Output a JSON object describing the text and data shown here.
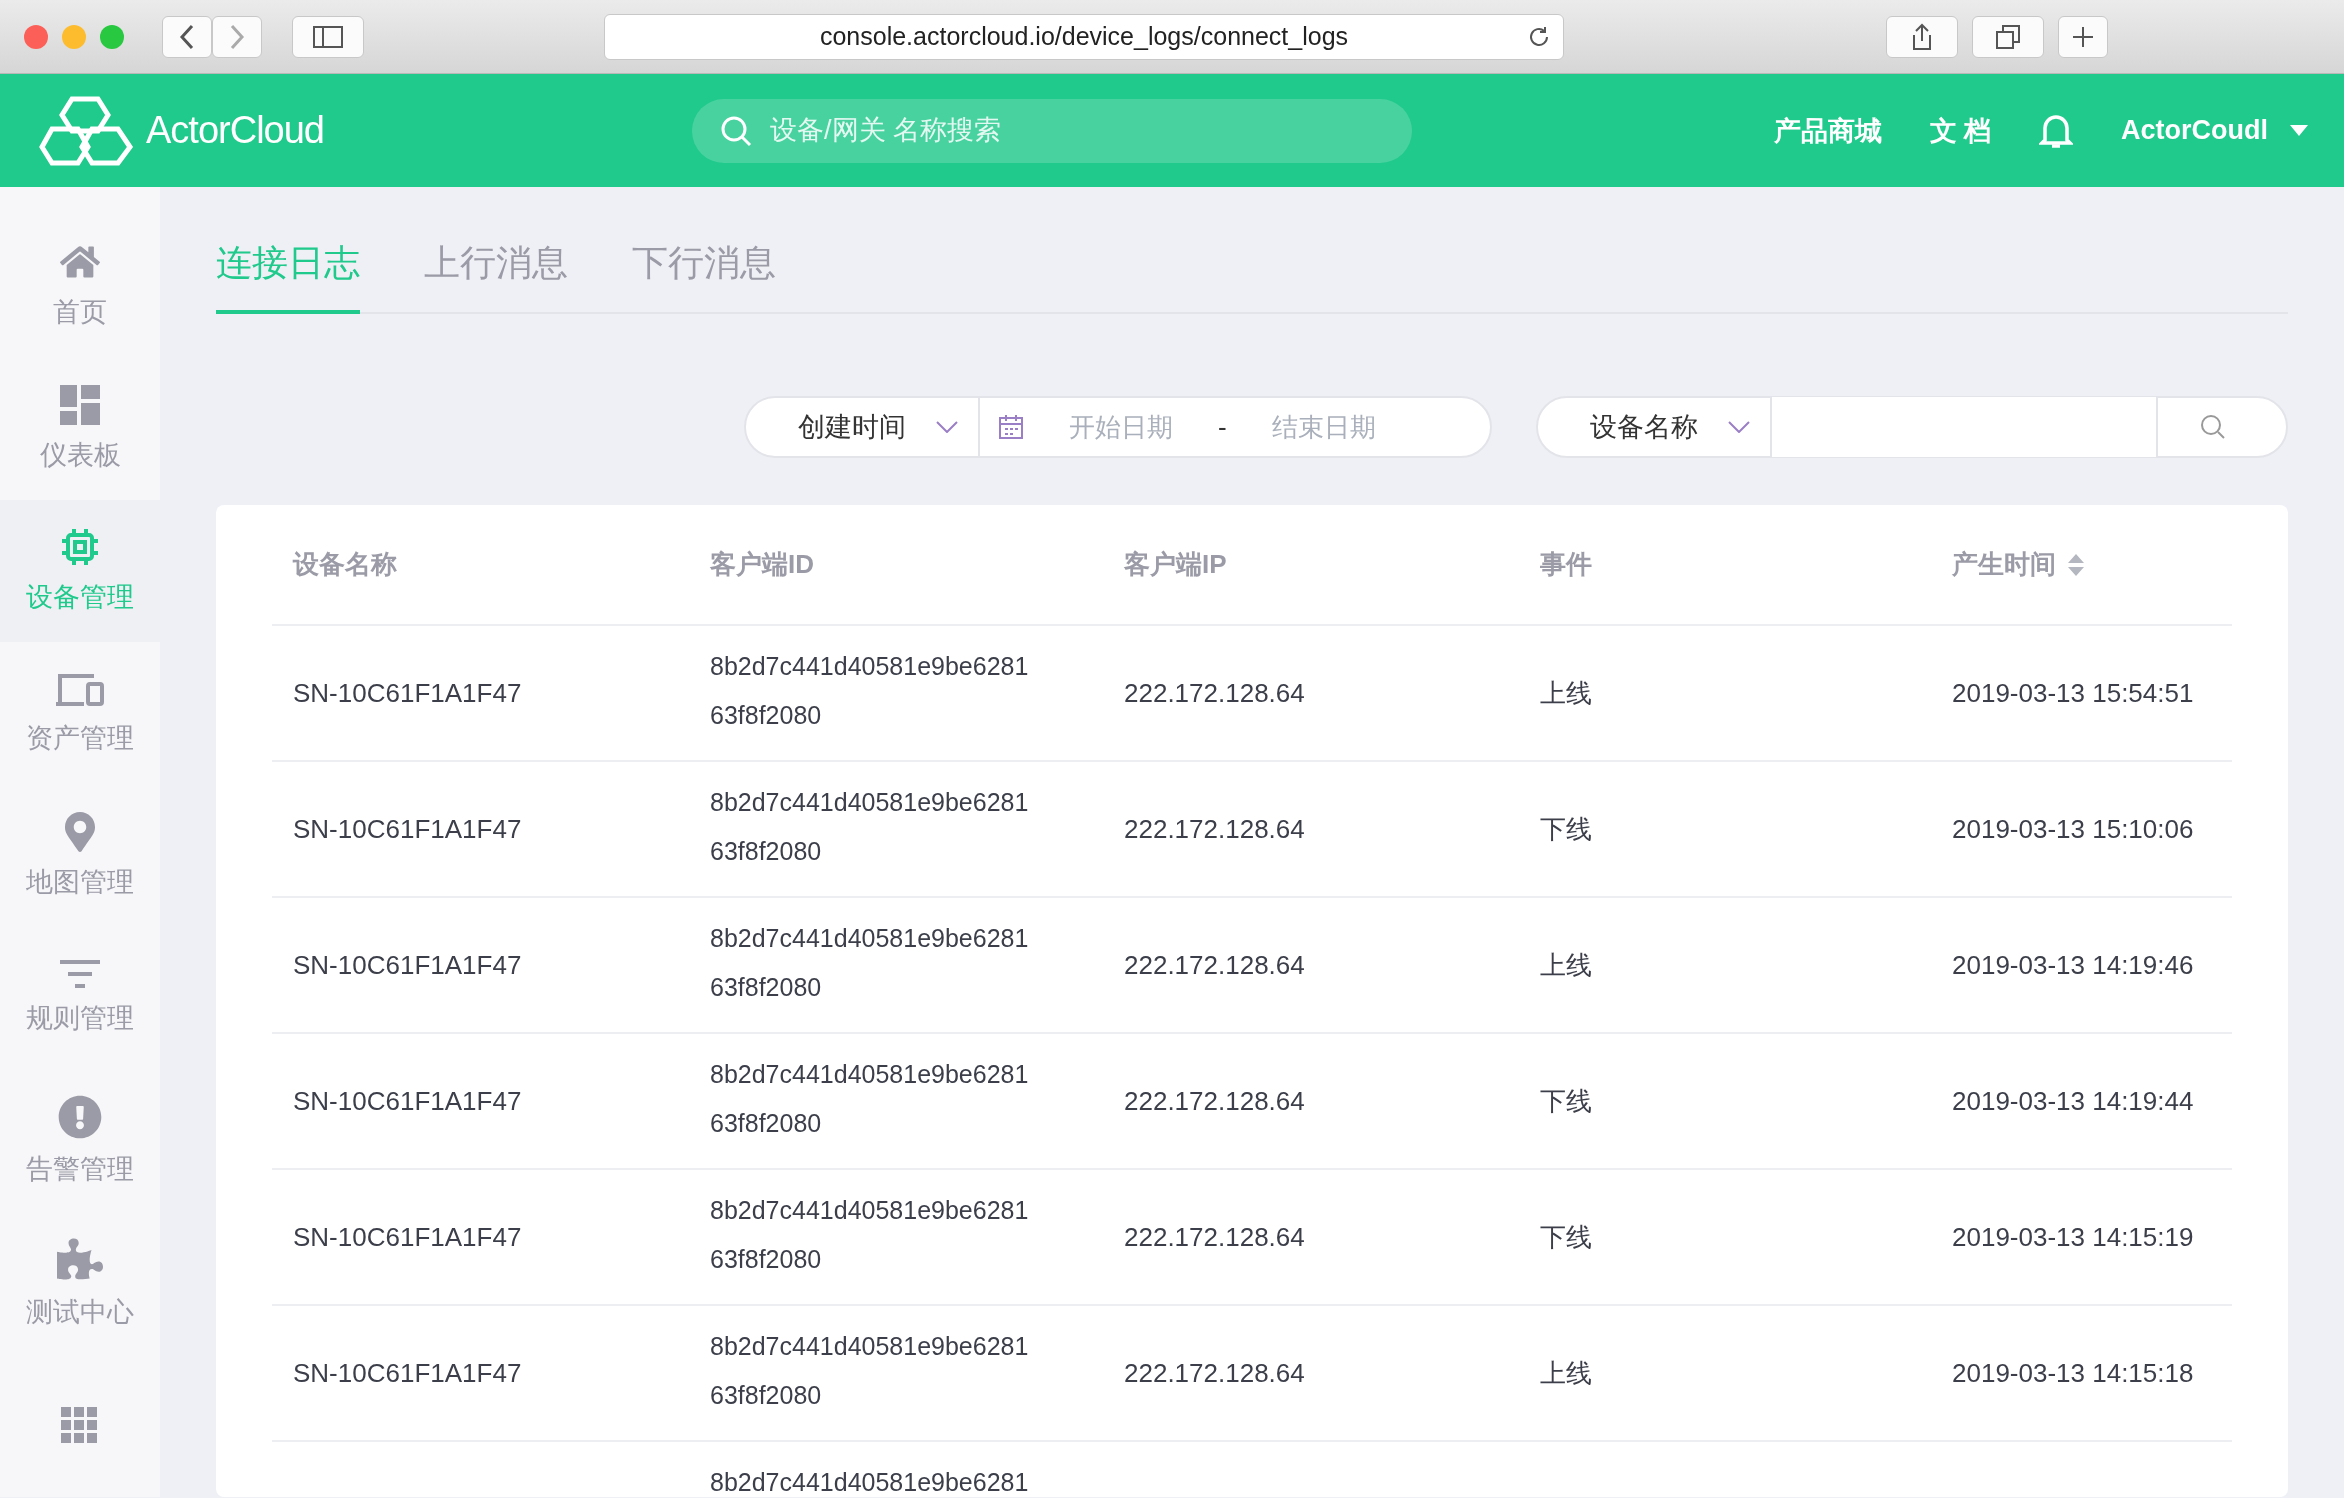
{
  "browser": {
    "url": "console.actorcloud.io/device_logs/connect_logs"
  },
  "header": {
    "logo": "ActorCloud",
    "search": {
      "placeholder": "设备/网关 名称搜索"
    },
    "links": [
      "产品商城",
      "文 档"
    ],
    "user": "ActorCoudl"
  },
  "sidebar": {
    "items": [
      {
        "label": "首页",
        "kind": "home",
        "selected": false
      },
      {
        "label": "仪表板",
        "kind": "dashboard",
        "selected": false
      },
      {
        "label": "设备管理",
        "kind": "device",
        "selected": true
      },
      {
        "label": "资产管理",
        "kind": "asset",
        "selected": false
      },
      {
        "label": "地图管理",
        "kind": "map",
        "selected": false
      },
      {
        "label": "规则管理",
        "kind": "rule",
        "selected": false
      },
      {
        "label": "告警管理",
        "kind": "alert",
        "selected": false
      },
      {
        "label": "测试中心",
        "kind": "test",
        "selected": false
      },
      {
        "kind": "apps",
        "selected": false
      }
    ]
  },
  "tabs": [
    {
      "label": "连接日志",
      "selected": true
    },
    {
      "label": "上行消息",
      "selected": false
    },
    {
      "label": "下行消息",
      "selected": false
    }
  ],
  "filters": {
    "time_field": "创建时间",
    "start": {
      "placeholder": "开始日期"
    },
    "separator": "-",
    "end": {
      "placeholder": "结束日期"
    },
    "search_field": "设备名称"
  },
  "table": {
    "columns": [
      "设备名称",
      "客户端ID",
      "客户端IP",
      "事件",
      "产生时间"
    ],
    "rows": [
      {
        "device": "SN-10C61F1A1F47",
        "client_id": [
          "8b2d7c441d40581e9be6281",
          "63f8f2080"
        ],
        "ip": "222.172.128.64",
        "event": "上线",
        "time": "2019-03-13 15:54:51"
      },
      {
        "device": "SN-10C61F1A1F47",
        "client_id": [
          "8b2d7c441d40581e9be6281",
          "63f8f2080"
        ],
        "ip": "222.172.128.64",
        "event": "下线",
        "time": "2019-03-13 15:10:06"
      },
      {
        "device": "SN-10C61F1A1F47",
        "client_id": [
          "8b2d7c441d40581e9be6281",
          "63f8f2080"
        ],
        "ip": "222.172.128.64",
        "event": "上线",
        "time": "2019-03-13 14:19:46"
      },
      {
        "device": "SN-10C61F1A1F47",
        "client_id": [
          "8b2d7c441d40581e9be6281",
          "63f8f2080"
        ],
        "ip": "222.172.128.64",
        "event": "下线",
        "time": "2019-03-13 14:19:44"
      },
      {
        "device": "SN-10C61F1A1F47",
        "client_id": [
          "8b2d7c441d40581e9be6281",
          "63f8f2080"
        ],
        "ip": "222.172.128.64",
        "event": "下线",
        "time": "2019-03-13 14:15:19"
      },
      {
        "device": "SN-10C61F1A1F47",
        "client_id": [
          "8b2d7c441d40581e9be6281",
          "63f8f2080"
        ],
        "ip": "222.172.128.64",
        "event": "上线",
        "time": "2019-03-13 14:15:18"
      },
      {
        "client_id": [
          "8b2d7c441d40581e9be6281"
        ]
      }
    ]
  }
}
